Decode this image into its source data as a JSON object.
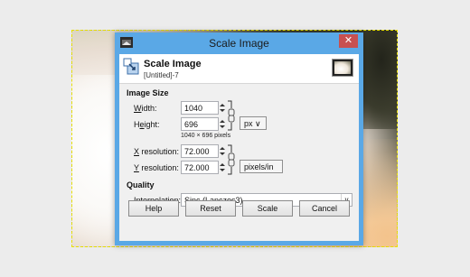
{
  "dialog": {
    "title": "Scale Image",
    "close_glyph": "✕",
    "header_title": "Scale Image",
    "header_subtitle": "[Untitled]-7",
    "app_icon": "gimp-wilber-icon",
    "header_icon": "scale-image-icon",
    "thumbnail": "image-thumbnail"
  },
  "image_size": {
    "section_title": "Image Size",
    "width_label_u": "W",
    "width_label_rest": "idth:",
    "width_value": "1040",
    "height_label_pre": "H",
    "height_label_u": "e",
    "height_label_rest": "ight:",
    "height_value": "696",
    "size_note": "1040 × 696 pixels",
    "unit": "px",
    "unit_arrow": "∨",
    "x_res_label_u": "X",
    "x_res_label_rest": " resolution:",
    "x_res_value": "72.000",
    "y_res_label_u": "Y",
    "y_res_label_rest": " resolution:",
    "y_res_value": "72.000",
    "res_unit": "pixels/in",
    "chain_icon": "chain-link-icon"
  },
  "quality": {
    "section_title": "Quality",
    "interp_label_u": "I",
    "interp_label_rest": "nterpolation:",
    "interp_value": "Sinc (Lanczos3)",
    "combo_arrow": "∨"
  },
  "buttons": {
    "help": "Help",
    "reset": "Reset",
    "scale": "Scale",
    "cancel": "Cancel"
  },
  "colors": {
    "titlebar": "#5aa8e6",
    "close": "#c75050"
  }
}
